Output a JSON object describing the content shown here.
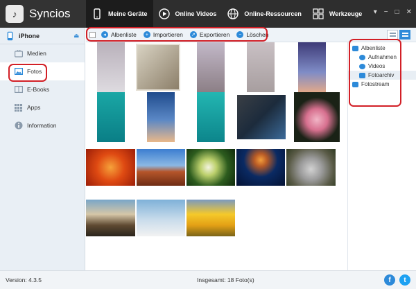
{
  "app": {
    "title": "Syncios"
  },
  "nav": {
    "items": [
      {
        "label": "Meine Geräte",
        "icon": "phone-icon",
        "active": true
      },
      {
        "label": "Online Videos",
        "icon": "play-icon"
      },
      {
        "label": "Online-Ressourcen",
        "icon": "globe-icon"
      },
      {
        "label": "Werkzeuge",
        "icon": "grid-icon"
      }
    ]
  },
  "window_controls": [
    "menu-icon",
    "minimize-icon",
    "maximize-icon",
    "close-icon"
  ],
  "sidebar": {
    "device": "iPhone",
    "items": [
      {
        "label": "Medien",
        "icon": "tv-icon"
      },
      {
        "label": "Fotos",
        "icon": "photo-icon",
        "active": true
      },
      {
        "label": "E-Books",
        "icon": "book-icon"
      },
      {
        "label": "Apps",
        "icon": "apps-icon"
      },
      {
        "label": "Information",
        "icon": "info-icon"
      }
    ]
  },
  "toolbar": {
    "buttons": [
      {
        "label": "Albenliste",
        "icon": "back-arrow-icon"
      },
      {
        "label": "Importieren",
        "icon": "import-icon"
      },
      {
        "label": "Exportieren",
        "icon": "export-icon"
      },
      {
        "label": "Löschen",
        "icon": "delete-icon"
      }
    ]
  },
  "albums": {
    "root": "Albenliste",
    "children": [
      "Aufnahmen",
      "Videos",
      "Fotoarchiv"
    ],
    "selected": "Fotoarchiv",
    "stream": "Fotostream"
  },
  "status": {
    "version": "Version: 4.3.5",
    "total": "Insgesamt: 18 Foto(s)"
  },
  "social": [
    "facebook-icon",
    "twitter-icon"
  ],
  "colors": {
    "accent": "#2d8ad9",
    "topbar": "#2e2e2e",
    "highlight": "#d21f26"
  }
}
